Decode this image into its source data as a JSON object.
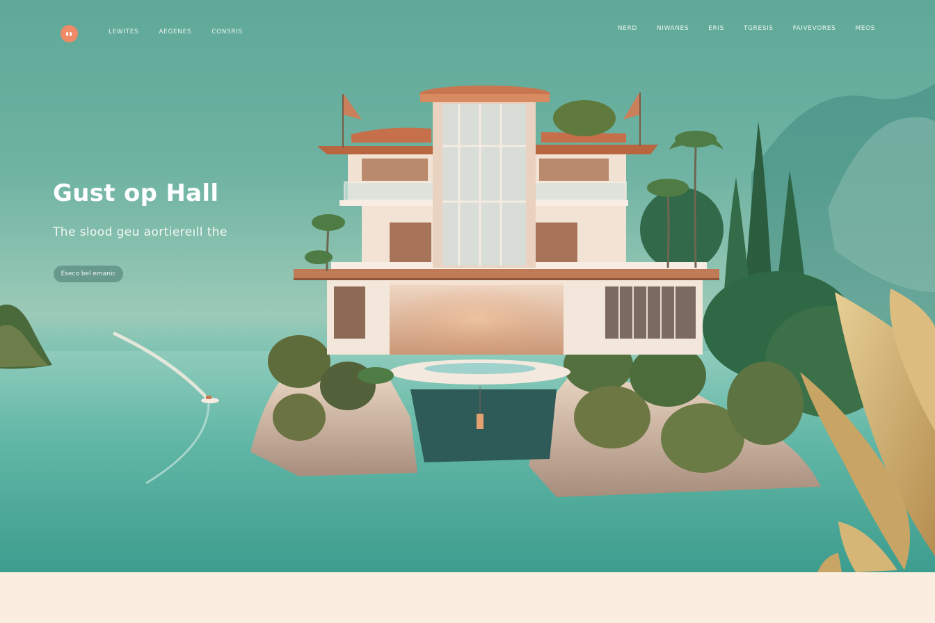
{
  "logo": {
    "text": "◖◗",
    "icon": "logo-badge-icon",
    "color": "#ef8a69"
  },
  "nav_left": [
    {
      "label": "LEWITES"
    },
    {
      "label": "AEGENES"
    },
    {
      "label": "CONSRIS"
    }
  ],
  "nav_right": [
    {
      "label": "NERD"
    },
    {
      "label": "NIWANES"
    },
    {
      "label": "ERIS"
    },
    {
      "label": "TGRESIS"
    },
    {
      "label": "FAIVEVORES"
    },
    {
      "label": "MEOS"
    }
  ],
  "hero": {
    "title": "Gust op Hall",
    "subtitle": "The slood geu aortiereıll the",
    "cta_label": "Eseco bel emanic"
  },
  "colors": {
    "sky": "#5fa898",
    "sea": "#5db3a4",
    "accent": "#ef8a69",
    "footer": "#fbeee1"
  }
}
